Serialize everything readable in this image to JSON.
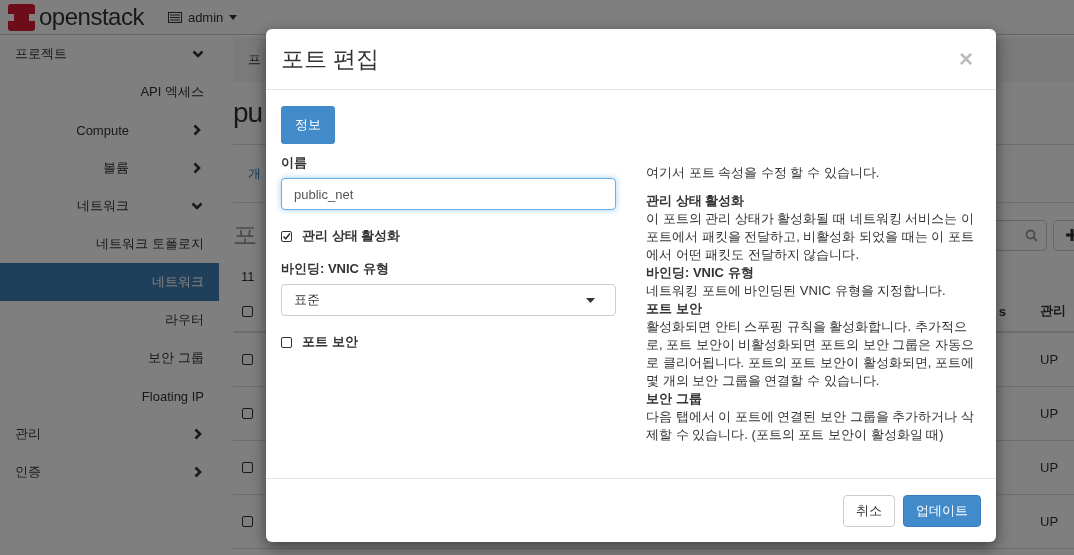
{
  "header": {
    "logo": "openstack",
    "user": "admin"
  },
  "sidebar": {
    "items": [
      {
        "label": "프로젝트",
        "kind": "section",
        "expanded": true,
        "selected": false
      },
      {
        "label": "API 엑세스",
        "kind": "link",
        "selected": false
      },
      {
        "label": "Compute",
        "kind": "group",
        "expanded": false,
        "selected": false
      },
      {
        "label": "볼륨",
        "kind": "group",
        "expanded": false,
        "selected": false
      },
      {
        "label": "네트워크",
        "kind": "group",
        "expanded": true,
        "selected": false
      },
      {
        "label": "네트워크 토폴로지",
        "kind": "link",
        "selected": false
      },
      {
        "label": "네트워크",
        "kind": "link",
        "selected": true
      },
      {
        "label": "라우터",
        "kind": "link",
        "selected": false
      },
      {
        "label": "보안 그룹",
        "kind": "link",
        "selected": false
      },
      {
        "label": "Floating IP",
        "kind": "link",
        "selected": false
      },
      {
        "label": "관리",
        "kind": "section",
        "expanded": false,
        "selected": false
      },
      {
        "label": "인증",
        "kind": "section",
        "expanded": false,
        "selected": false
      }
    ]
  },
  "page": {
    "breadcrumb": "프",
    "title": "pu",
    "tab": "개",
    "section_title": "포",
    "row_count": "11",
    "table": {
      "select_all_checked": false,
      "columns": [
        "s",
        "관리"
      ],
      "rows": [
        {
          "checked": false,
          "admin_state": "UP"
        },
        {
          "checked": false,
          "admin_state": "UP"
        },
        {
          "checked": false,
          "admin_state": "UP"
        },
        {
          "checked": false,
          "admin_state": "UP"
        }
      ]
    }
  },
  "modal": {
    "title": "포트 편집",
    "close": "×",
    "tabs": [
      {
        "label": "정보",
        "selected": true
      }
    ],
    "name_label": "이름",
    "name_value": "public_net",
    "admin_state": {
      "label": "관리 상태 활성화",
      "checked": true
    },
    "vnic_label": "바인딩: VNIC 유형",
    "vnic_value": "표준",
    "port_security": {
      "label": "포트 보안",
      "checked": false
    },
    "help_intro": "여기서 포트 속성을 수정 할 수 있습니다.",
    "help_sections": [
      {
        "heading": "관리 상태 활성화",
        "text": "이 포트의 관리 상태가 활성화될 때 네트워킹 서비스는 이 포트에서 패킷을 전달하고, 비활성화 되었을 때는 이 포트에서 어떤 패킷도 전달하지 않습니다."
      },
      {
        "heading": "바인딩: VNIC 유형",
        "text": "네트워킹 포트에 바인딩된 VNIC 유형을 지정합니다."
      },
      {
        "heading": "포트 보안",
        "text": "활성화되면 안티 스푸핑 규칙을 활성화합니다. 추가적으로, 포트 보안이 비활성화되면 포트의 보안 그룹은 자동으로 클리어됩니다. 포트의 포트 보안이 활성화되면, 포트에 몇 개의 보안 그룹을 연결할 수 있습니다."
      },
      {
        "heading": "보안 그룹",
        "text": "다음 탭에서 이 포트에 연결된 보안 그룹을 추가하거나 삭제할 수 있습니다. (포트의 포트 보안이 활성화일 때)"
      }
    ],
    "buttons": [
      {
        "label": "취소",
        "kind": "default"
      },
      {
        "label": "업데이트",
        "kind": "primary"
      }
    ]
  }
}
